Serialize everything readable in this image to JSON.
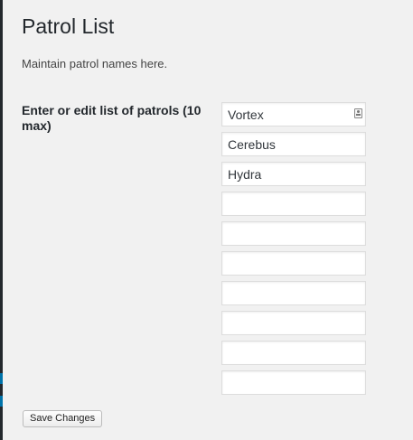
{
  "page": {
    "title": "Patrol List",
    "description": "Maintain patrol names here."
  },
  "form": {
    "label": "Enter or edit list of patrols (10 max)",
    "patrols": [
      "Vortex",
      "Cerebus",
      "Hydra",
      "",
      "",
      "",
      "",
      "",
      "",
      ""
    ],
    "save_label": "Save Changes"
  },
  "colors": {
    "background": "#f1f1f1",
    "sidebar_edge": "#23282d",
    "edge_accent": "#0073aa"
  },
  "icons": {
    "autofill": "contact-card-icon"
  }
}
